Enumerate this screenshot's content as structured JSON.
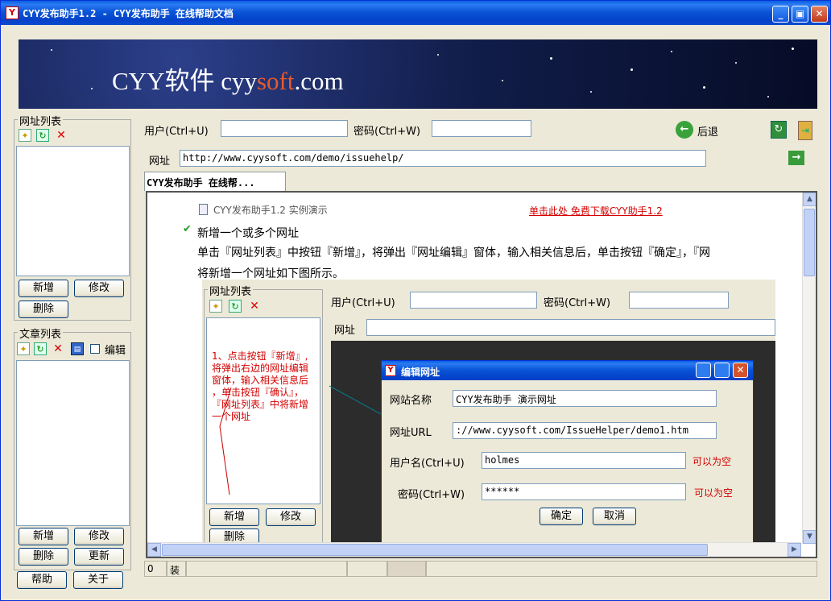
{
  "window": {
    "title": "CYY发布助手1.2 - CYY发布助手 在线帮助文档",
    "icon_letter": "Y"
  },
  "banner": {
    "text_pre": "CYY软件 cyy",
    "text_soft": "soft",
    "text_post": ".com"
  },
  "url_group": {
    "label": "网址列表",
    "add_btn": "新增",
    "edit_btn": "修改",
    "delete_btn": "删除"
  },
  "article_group": {
    "label": "文章列表",
    "edit_checkbox_label": "编辑",
    "add_btn": "新增",
    "edit_btn": "修改",
    "delete_btn": "删除",
    "update_btn": "更新"
  },
  "footer_buttons": {
    "help": "帮助",
    "about": "关于"
  },
  "main": {
    "user_label": "用户(Ctrl+U)",
    "user_value": "",
    "password_label": "密码(Ctrl+W)",
    "password_value": "",
    "back_label": "后退",
    "url_label": "网址",
    "url_value": "http://www.cyysoft.com/demo/issuehelp/",
    "tab_label": "CYY发布助手 在线帮..."
  },
  "page": {
    "doc_title": "CYY发布助手1.2 实例演示",
    "download_link": "单击此处 免费下载CYY助手1.2",
    "section_title": "新增一个或多个网址",
    "paragraph_line1": "单击『网址列表』中按钮『新增』，将弹出『网址编辑』窗体，输入相关信息后，单击按钮『确定』，『网",
    "paragraph_line2": "将新增一个网址如下图所示。",
    "inner": {
      "group_label": "网址列表",
      "user_label": "用户(Ctrl+U)",
      "password_label": "密码(Ctrl+W)",
      "url_label": "网址",
      "add_btn": "新增",
      "edit_btn": "修改",
      "delete_btn": "删除",
      "note_lines": [
        "1、点击按钮『新增』,",
        "将弹出右边的网址编辑",
        "窗体，输入相关信息后",
        "，单击按钮『确认』，",
        "『网址列表』中将新增",
        "一个网址"
      ],
      "dialog": {
        "title": "编辑网址",
        "site_name_label": "网站名称",
        "site_name_value": "CYY发布助手 演示网址",
        "url_label": "网址URL",
        "url_value": "://www.cyysoft.com/IssueHelper/demo1.htm",
        "user_label": "用户名(Ctrl+U)",
        "user_value": "holmes",
        "user_hint": "可以为空",
        "password_label": "密码(Ctrl+W)",
        "password_value": "******",
        "password_hint": "可以为空",
        "ok_btn": "确定",
        "cancel_btn": "取消"
      }
    }
  },
  "status": {
    "cell1": "0",
    "cell2": "装"
  },
  "colors": {
    "accent_red": "#d40000",
    "title_blue": "#0a4ad0",
    "window_face": "#ece9d8"
  }
}
